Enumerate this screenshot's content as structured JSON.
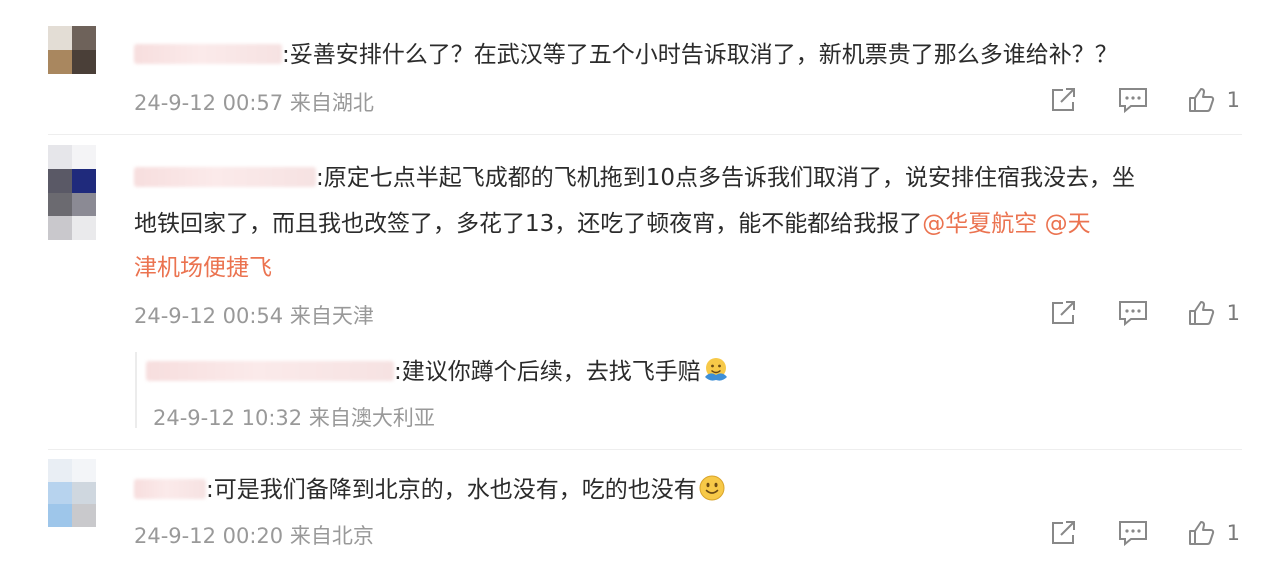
{
  "comments": [
    {
      "text": ":妥善安排什么了？在武汉等了五个小时告诉取消了，新机票贵了那么多谁给补？？",
      "time": "24-9-12 00:57 来自湖北",
      "likes": "1"
    },
    {
      "line1": ":原定七点半起飞成都的飞机拖到10点多告诉我们取消了，说安排住宿我没去，坐",
      "line2_text": "地铁回家了，而且我也改签了，多花了13，还吃了顿夜宵，能不能都给我报了",
      "mention1": "@华夏航空",
      "mention2_part1": "@天",
      "mention2_part2": "津机场便捷飞",
      "time": "24-9-12 00:54 来自天津",
      "likes": "1"
    },
    {
      "text": ":建议你蹲个后续，去找飞手赔",
      "time": "24-9-12 10:32 来自澳大利亚"
    },
    {
      "text": ":可是我们备降到北京的，水也没有，吃的也没有",
      "time": "24-9-12 00:20 来自北京",
      "likes": "1"
    }
  ],
  "icons": {
    "share": "share-icon",
    "comment": "comment-icon",
    "like": "thumbs-up-icon",
    "emoji_hug": "hug-emoji-icon",
    "emoji_smile": "smile-emoji-icon"
  },
  "colors": {
    "mention": "#eb7350",
    "meta": "#999999",
    "text": "#2b2b2b"
  }
}
